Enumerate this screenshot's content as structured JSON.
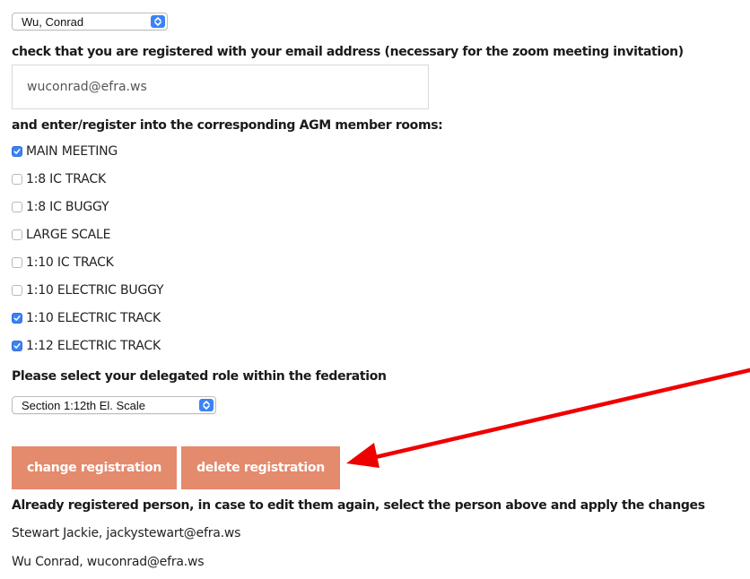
{
  "person_select": {
    "selected": "Wu, Conrad"
  },
  "email_section": {
    "label": "check that you are registered with your email address (necessary for the zoom meeting invitation)",
    "email_value": "wuconrad@efra.ws"
  },
  "rooms_section": {
    "label": "and enter/register into the corresponding AGM member rooms:",
    "items": [
      {
        "label": "MAIN MEETING",
        "checked": true
      },
      {
        "label": "1:8 IC TRACK",
        "checked": false
      },
      {
        "label": "1:8 IC BUGGY",
        "checked": false
      },
      {
        "label": "LARGE SCALE",
        "checked": false
      },
      {
        "label": "1:10 IC TRACK",
        "checked": false
      },
      {
        "label": "1:10 ELECTRIC BUGGY",
        "checked": false
      },
      {
        "label": "1:10 ELECTRIC TRACK",
        "checked": true
      },
      {
        "label": "1:12 ELECTRIC TRACK",
        "checked": true
      }
    ]
  },
  "role_section": {
    "label": "Please select your delegated role within the federation",
    "selected": "Section 1:12th El. Scale"
  },
  "buttons": {
    "change_label": "change registration",
    "delete_label": "delete registration"
  },
  "registered_section": {
    "label": "Already registered person, in case to edit them again, select the person above and apply the changes",
    "people": [
      "Stewart Jackie, jackystewart@efra.ws",
      "Wu Conrad, wuconrad@efra.ws"
    ]
  },
  "colors": {
    "button_bg": "#e48a6d",
    "checkbox_checked": "#3b82f6",
    "annotation_arrow": "#ee0000"
  },
  "icons": {
    "select_arrows": "updown-chevron-icon",
    "checkbox_checked": "checkmark-icon",
    "annotation": "red-arrow-icon"
  }
}
